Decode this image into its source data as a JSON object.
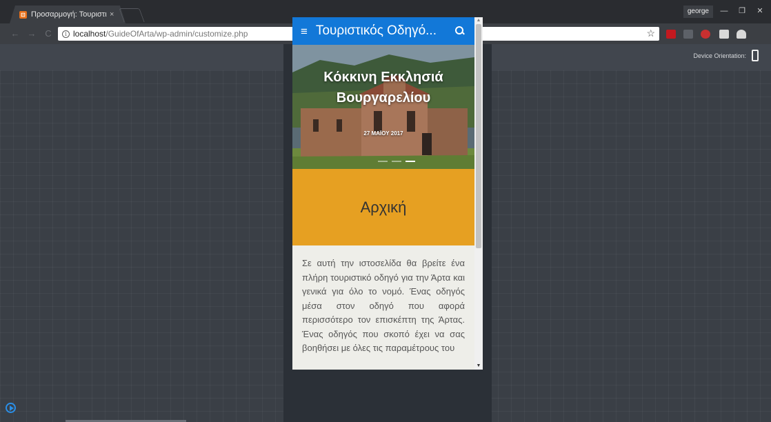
{
  "browser": {
    "tab_title": "Προσαρμογή: Τουριστικ",
    "tab_close": "×",
    "profile_name": "george",
    "window_buttons": [
      "—",
      "❐",
      "✕"
    ],
    "url_host": "localhost",
    "url_path": "/GuideOfArta/wp-admin/customize.php",
    "info_icon_glyph": "i",
    "star_glyph": "☆",
    "nav": {
      "back": "←",
      "forward": "→",
      "reload": "C"
    },
    "extension_colors": [
      "#c2191f",
      "#5d6168",
      "#c93030",
      "#d9d9d9",
      "#d9d9d9"
    ]
  },
  "customizer": {
    "device_orientation_label": "Device Orientation:"
  },
  "site": {
    "menu_glyph": "≡",
    "title": "Τουριστικός Οδηγό...",
    "hero_title": "Κόκκινη Εκκλησιά Βουργαρελίου",
    "hero_date": "27 ΜΑΪΟΥ 2017",
    "home_title": "Αρχική",
    "intro_text": "Σε αυτή την ιστοσελίδα θα βρείτε ένα πλήρη τουριστικό οδηγό για την Άρτα και γενικά για όλο το νομό. Ένας οδηγός μέσα στον οδηγό που αφορά περισσότερο τον επισκέπτη της Άρτας. Ένας οδηγός που σκοπό έχει να σας βοηθήσει με όλες τις παραμέτρους του",
    "scroll_up": "▲",
    "scroll_down": "▼",
    "colors": {
      "header": "#1278d8",
      "home_block": "#e6a022"
    }
  }
}
